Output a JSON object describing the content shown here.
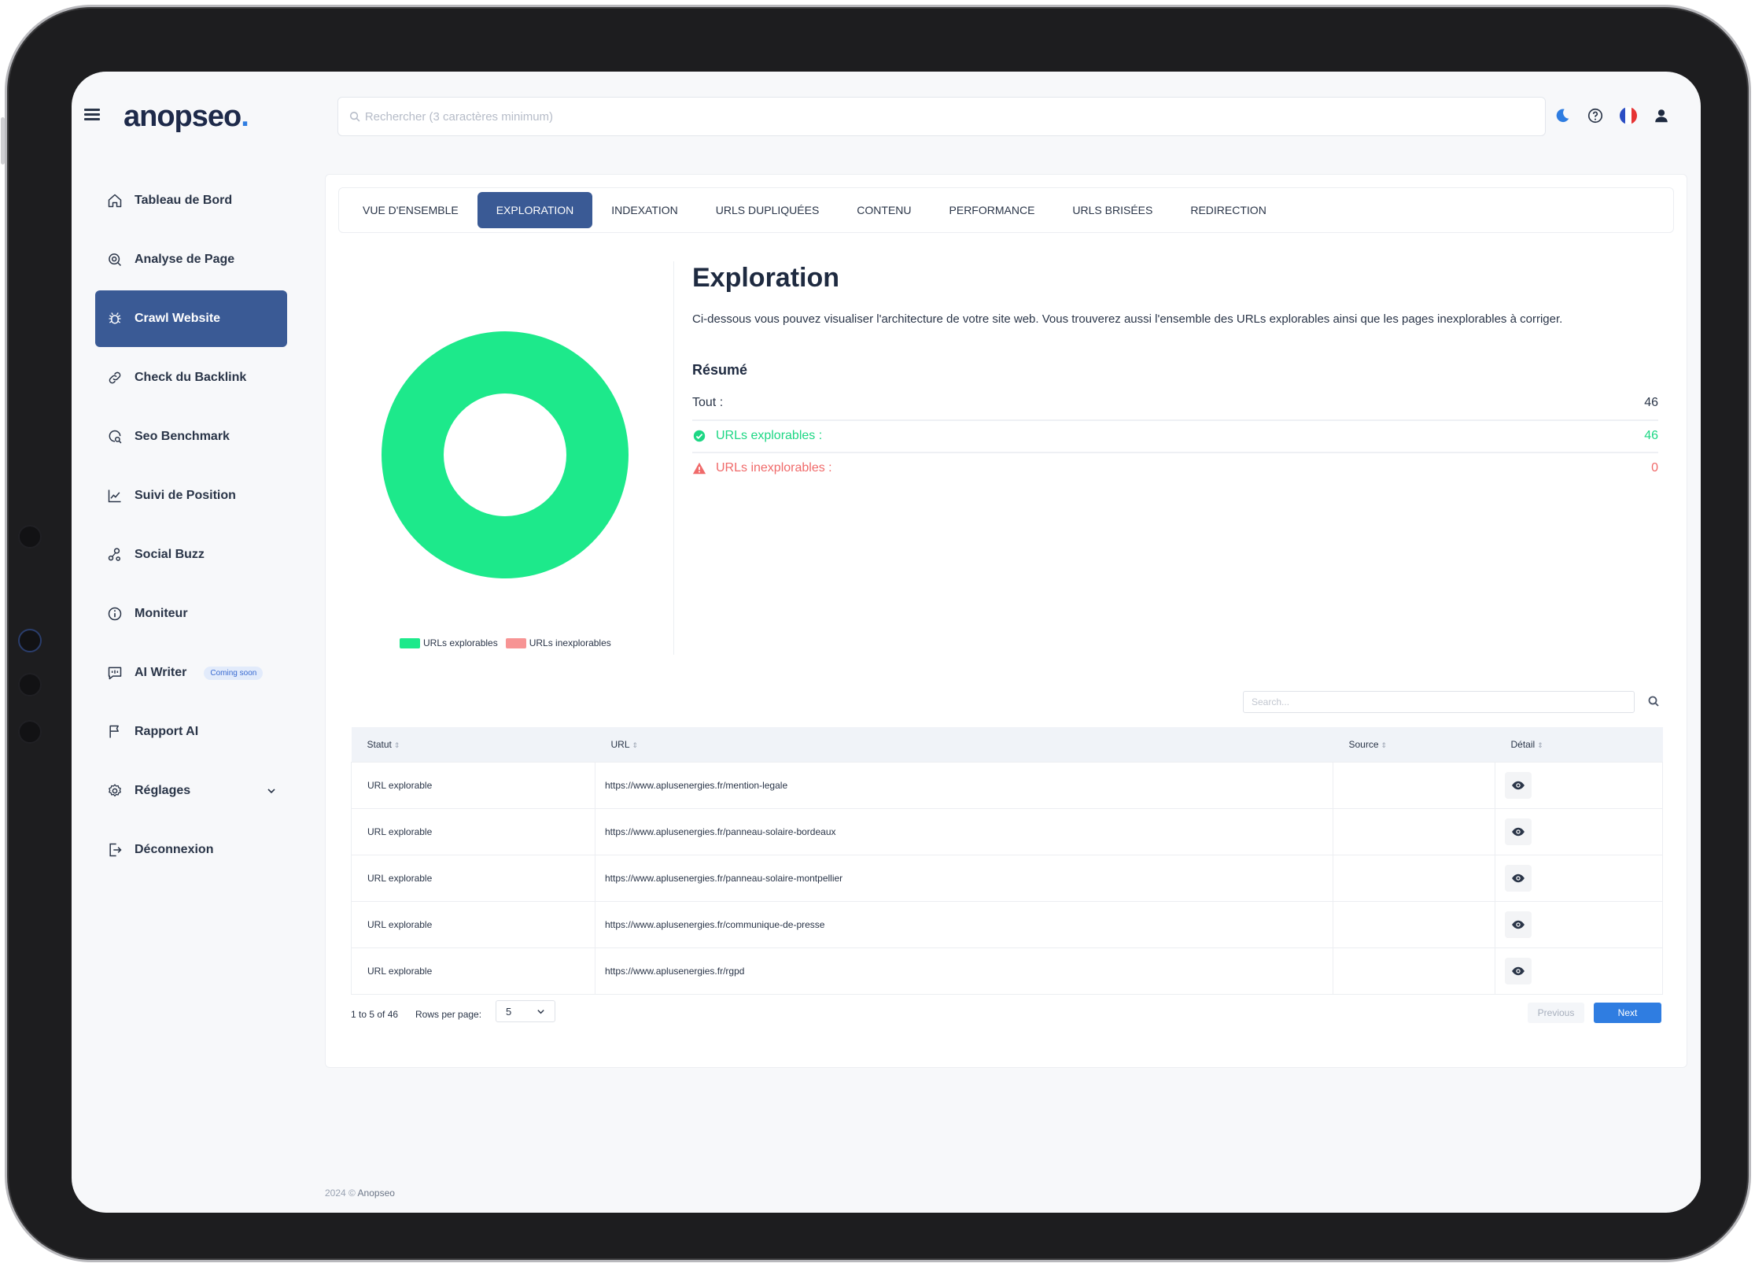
{
  "app": {
    "logo_main": "anopseo",
    "logo_dot": "."
  },
  "search": {
    "placeholder": "Rechercher (3 caractères minimum)"
  },
  "header_icons": [
    "moon-icon",
    "help-icon",
    "flag-fr-icon",
    "user-icon"
  ],
  "sidebar": {
    "items": [
      {
        "label": "Tableau de Bord",
        "icon": "home-icon"
      },
      {
        "label": "Analyse de Page",
        "icon": "page-search-icon"
      },
      {
        "label": "Crawl Website",
        "icon": "bug-icon",
        "active": true
      },
      {
        "label": "Check du Backlink",
        "icon": "link-icon"
      },
      {
        "label": "Seo Benchmark",
        "icon": "benchmark-icon"
      },
      {
        "label": "Suivi de Position",
        "icon": "chart-line-icon"
      },
      {
        "label": "Social Buzz",
        "icon": "social-icon"
      },
      {
        "label": "Moniteur",
        "icon": "info-icon"
      },
      {
        "label": "AI Writer",
        "icon": "chat-icon",
        "badge": "Coming soon"
      },
      {
        "label": "Rapport AI",
        "icon": "flag-icon"
      },
      {
        "label": "Réglages",
        "icon": "gear-icon",
        "expandable": true
      },
      {
        "label": "Déconnexion",
        "icon": "logout-icon"
      }
    ]
  },
  "tabs": [
    {
      "label": "VUE D'ENSEMBLE"
    },
    {
      "label": "EXPLORATION",
      "active": true
    },
    {
      "label": "INDEXATION"
    },
    {
      "label": "URLS DUPLIQUÉES"
    },
    {
      "label": "CONTENU"
    },
    {
      "label": "PERFORMANCE"
    },
    {
      "label": "URLS BRISÉES"
    },
    {
      "label": "REDIRECTION"
    }
  ],
  "chart_data": {
    "type": "pie",
    "categories": [
      "URLs explorables",
      "URLs inexplorables"
    ],
    "values": [
      46,
      0
    ],
    "colors": [
      "#1de98b",
      "#f79494"
    ],
    "legend": "bottom"
  },
  "exploration": {
    "title": "Exploration",
    "description": "Ci-dessous vous pouvez visualiser l'architecture de votre site web. Vous trouverez aussi l'ensemble des URLs explorables ainsi que les pages inexplorables à corriger.",
    "resume_title": "Résumé",
    "rows": [
      {
        "label": "Tout :",
        "value": "46",
        "color": "#2a3548"
      },
      {
        "label": "URLs explorables :",
        "value": "46",
        "color": "#1dd784"
      },
      {
        "label": "URLs inexplorables :",
        "value": "0",
        "color": "#f06a6a"
      }
    ]
  },
  "table": {
    "search_placeholder": "Search...",
    "headers": [
      "Statut",
      "URL",
      "Source",
      "Détail"
    ],
    "sort_glyph": "⇕",
    "rows": [
      {
        "statut": "URL explorable",
        "url": "https://www.aplusenergies.fr/mention-legale",
        "source": ""
      },
      {
        "statut": "URL explorable",
        "url": "https://www.aplusenergies.fr/panneau-solaire-bordeaux",
        "source": ""
      },
      {
        "statut": "URL explorable",
        "url": "https://www.aplusenergies.fr/panneau-solaire-montpellier",
        "source": ""
      },
      {
        "statut": "URL explorable",
        "url": "https://www.aplusenergies.fr/communique-de-presse",
        "source": ""
      },
      {
        "statut": "URL explorable",
        "url": "https://www.aplusenergies.fr/rgpd",
        "source": ""
      }
    ]
  },
  "pagination": {
    "info": "1 to 5 of 46",
    "rows_per_page_label": "Rows per page:",
    "rows_per_page": "5",
    "previous": "Previous",
    "next": "Next"
  },
  "footer": {
    "year": "2024 ©",
    "brand": "Anopseo"
  }
}
